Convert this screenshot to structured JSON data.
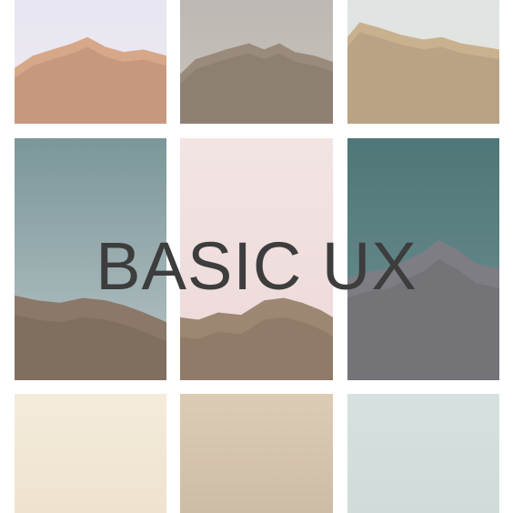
{
  "title": "BASIC UX",
  "colors": {
    "text": "#3d3d3d",
    "background": "#ffffff"
  },
  "tiles": [
    {
      "name": "photo-tile-sand-mountain",
      "sky": "#e7e6f1",
      "sky_bottom": "#efe9ee",
      "ground": "#d7a78a"
    },
    {
      "name": "photo-tile-grey-mountain",
      "sky": "#bdb8b3",
      "sky_bottom": "#c9c2bb",
      "ground": "#9a8a7c"
    },
    {
      "name": "photo-tile-beige-hills",
      "sky": "#dfe4e3",
      "sky_bottom": "#e6e4dc",
      "ground": "#c9b190"
    },
    {
      "name": "photo-tile-teal-sky-ridge",
      "sky": "#7b9799",
      "sky_bottom": "#b8c3c6",
      "ground": "#8b7868"
    },
    {
      "name": "photo-tile-pink-sky-ridge",
      "sky": "#f3e4e4",
      "sky_bottom": "#ecd9d8",
      "ground": "#9d8672"
    },
    {
      "name": "photo-tile-dark-teal-peak",
      "sky": "#4f7678",
      "sky_bottom": "#6f9090",
      "ground": "#7e7d83"
    },
    {
      "name": "color-swatch-cream",
      "sky": "#f4ebdb",
      "sky_bottom": "#efe3cf",
      "ground": null
    },
    {
      "name": "color-swatch-tan",
      "sky": "#dccbb5",
      "sky_bottom": "#cdbca6",
      "ground": null
    },
    {
      "name": "color-swatch-pale-aqua",
      "sky": "#d5e1de",
      "sky_bottom": "#cfdcda",
      "ground": null
    }
  ]
}
